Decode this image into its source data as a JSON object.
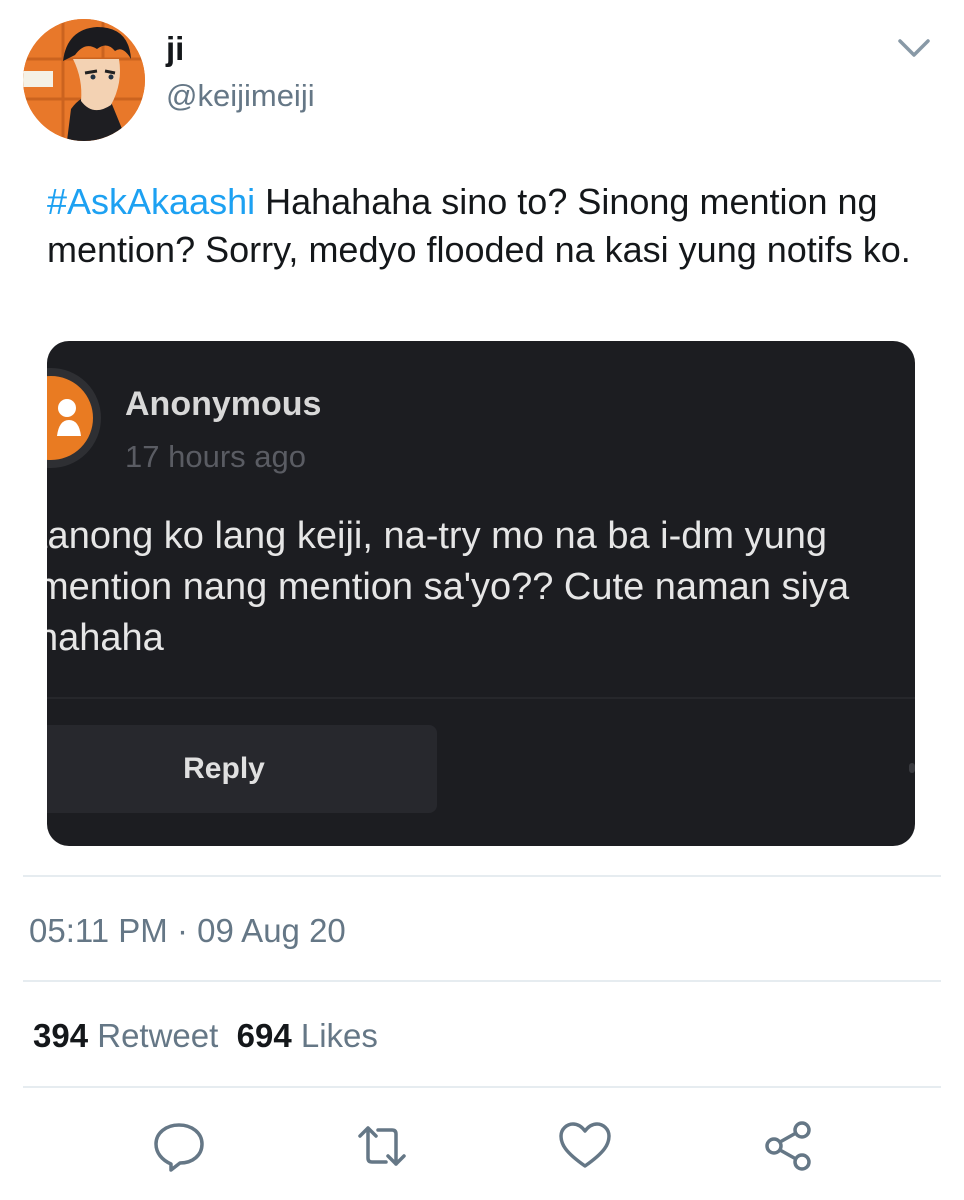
{
  "user": {
    "display_name": "ji",
    "handle": "@keijimeiji"
  },
  "tweet": {
    "hashtag": "#AskAkaashi",
    "text": " Hahahaha sino to? Sinong mention ng mention? Sorry, medyo flooded na kasi yung notifs ko."
  },
  "media": {
    "sender": "Anonymous",
    "time": "17 hours ago",
    "question_lines": [
      "tanong ko lang keiji, na-try mo na ba i-dm yung",
      "mention nang mention sa'yo?? Cute naman siya",
      "hahaha"
    ],
    "reply_label": "Reply"
  },
  "meta": {
    "timestamp": "05:11 PM · 09 Aug 20"
  },
  "stats": {
    "retweet_count": "394",
    "retweet_label": "Retweet",
    "like_count": "694",
    "like_label": "Likes"
  },
  "icons": {
    "reply": "reply-icon",
    "retweet": "retweet-icon",
    "like": "heart-icon",
    "share": "share-icon",
    "menu": "chevron-down-icon"
  },
  "colors": {
    "link": "#1da1f2",
    "muted": "#657786",
    "text": "#14171a",
    "media_bg": "#1c1d21"
  }
}
